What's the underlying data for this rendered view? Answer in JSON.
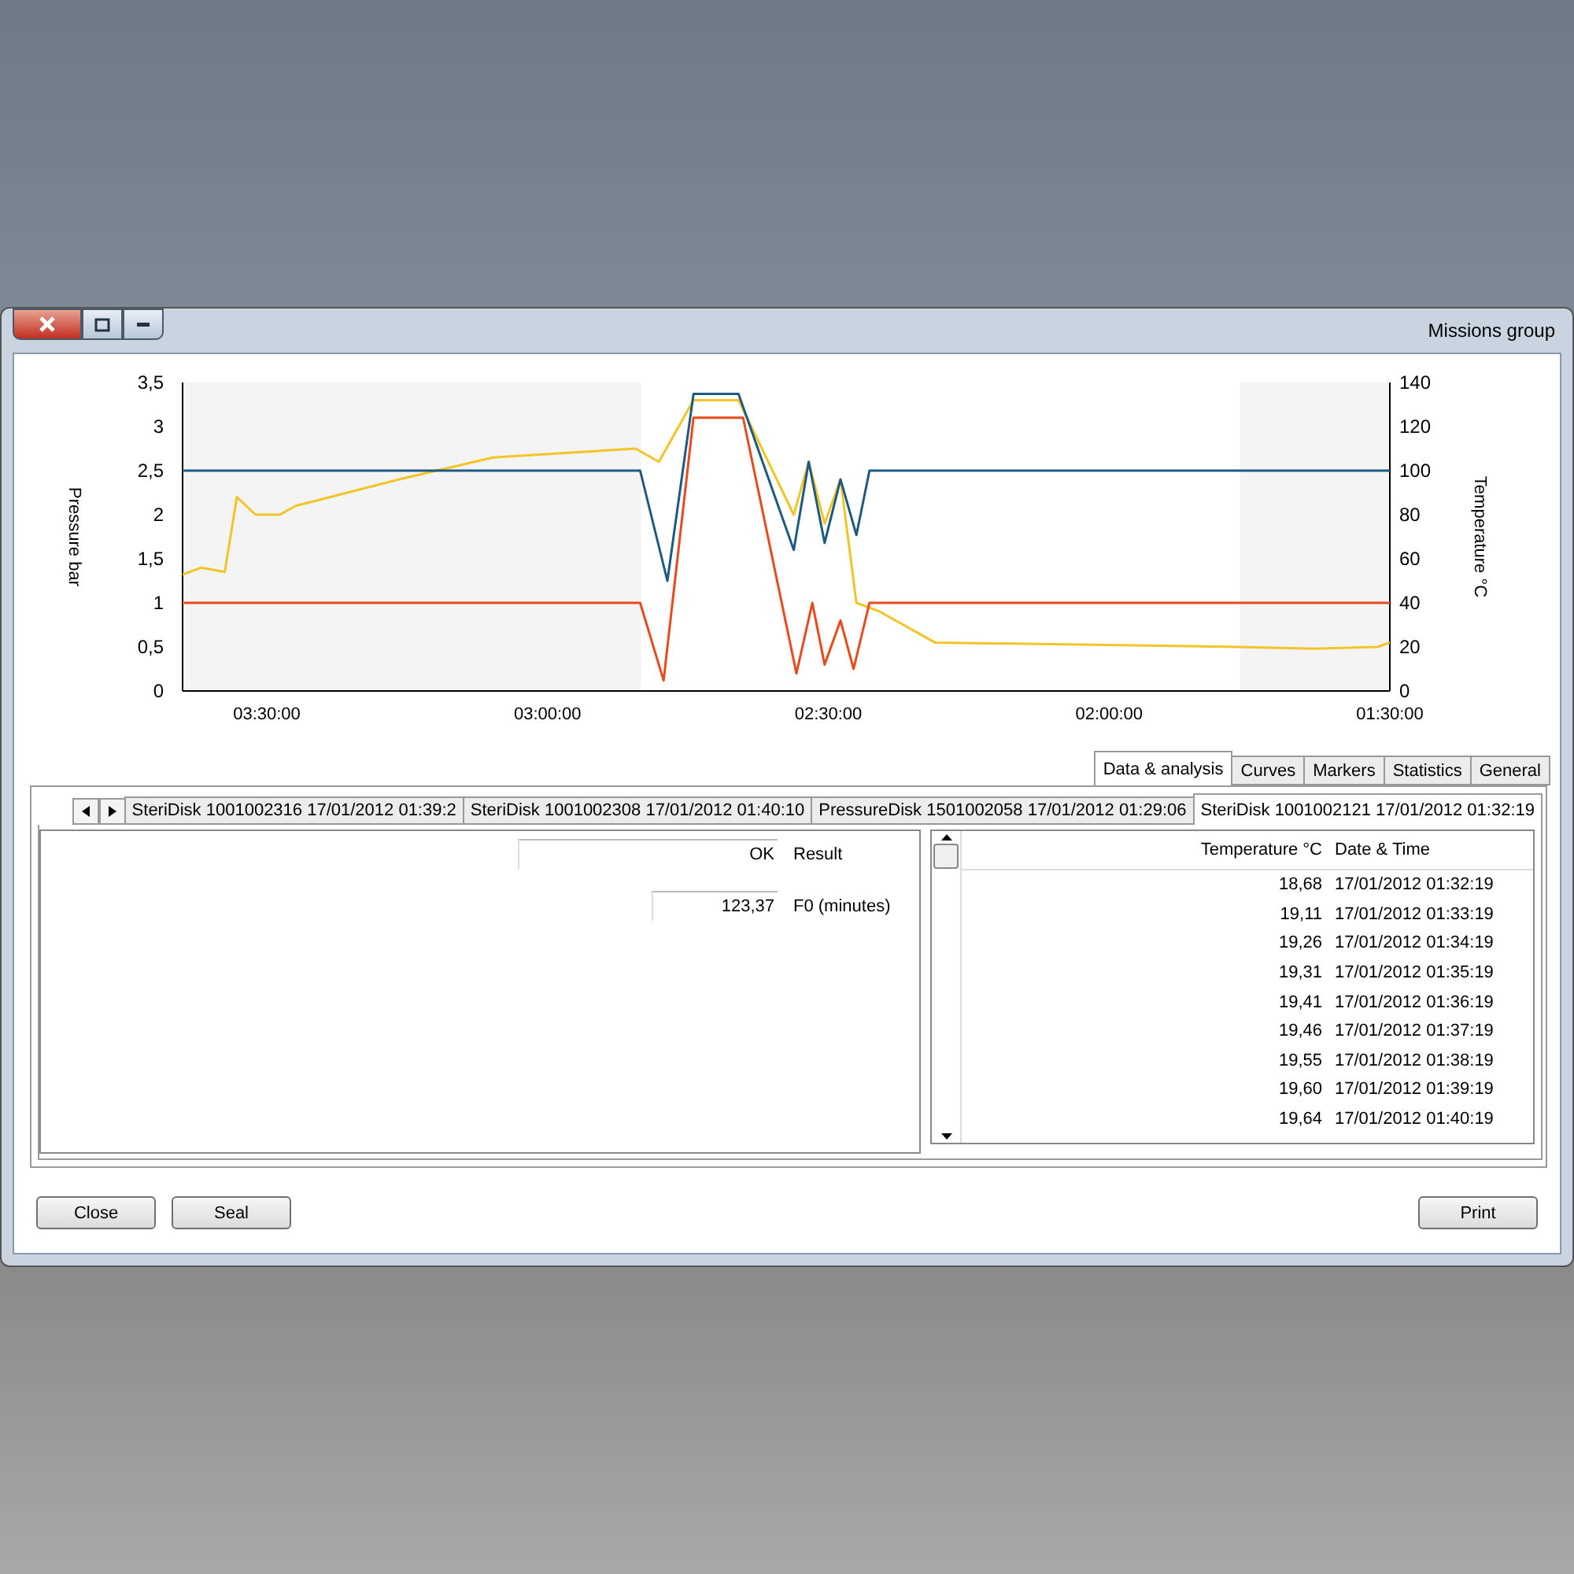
{
  "window": {
    "title": "Missions group"
  },
  "chart": {
    "y_label_left": "Pressure bar",
    "y_label_right": "Temperature °C",
    "chart_data": {
      "type": "line",
      "xlim": [
        219,
        90
      ],
      "ylim": [
        0,
        3.5
      ],
      "xticks": [
        {
          "value": 210,
          "label": "03:30:00"
        },
        {
          "value": 180,
          "label": "03:00:00"
        },
        {
          "value": 150,
          "label": "02:30:00"
        },
        {
          "value": 120,
          "label": "02:00:00"
        },
        {
          "value": 90,
          "label": "01:30:00"
        }
      ],
      "yticks": [
        {
          "value": 0,
          "label": "0"
        },
        {
          "value": 0.5,
          "label": "0,5"
        },
        {
          "value": 1,
          "label": "1"
        },
        {
          "value": 1.5,
          "label": "1,5"
        },
        {
          "value": 2,
          "label": "2"
        },
        {
          "value": 2.5,
          "label": "2,5"
        },
        {
          "value": 3,
          "label": "3"
        },
        {
          "value": 3.5,
          "label": "3,5"
        }
      ],
      "y2lim": [
        0,
        140
      ],
      "y2ticks": [
        0,
        20,
        40,
        60,
        80,
        100,
        120,
        140
      ],
      "bands": [
        {
          "axis": "x",
          "from": 219,
          "to": 170
        },
        {
          "axis": "x",
          "from": 106,
          "to": 90
        }
      ],
      "series": [
        {
          "color": "#f2c428",
          "x": [
            219,
            217,
            214.5,
            213.2,
            211.2,
            208.6,
            206.9,
            195.9,
            185.8,
            170.6,
            168.1,
            164.4,
            159.6,
            153.7,
            152.1,
            150.4,
            148.7,
            147,
            144.5,
            138.6,
            106.5,
            98.1,
            91.3,
            90
          ],
          "values": [
            1.32,
            1.4,
            1.35,
            2.2,
            2.0,
            2.0,
            2.1,
            2.4,
            2.65,
            2.75,
            2.6,
            3.3,
            3.3,
            2.0,
            2.6,
            1.9,
            2.4,
            1.0,
            0.9,
            0.55,
            0.5,
            0.48,
            0.5,
            0.55
          ]
        },
        {
          "color": "#1d5a80",
          "x": [
            219,
            170.1,
            167.2,
            164.4,
            159.6,
            153.7,
            152.1,
            150.4,
            148.7,
            147,
            145.6,
            90
          ],
          "values": [
            2.5,
            2.5,
            1.25,
            3.37,
            3.37,
            1.6,
            2.6,
            1.68,
            2.4,
            1.77,
            2.5,
            2.5
          ]
        },
        {
          "color": "#e84a1c",
          "x": [
            219,
            170.1,
            167.6,
            164.4,
            159.1,
            153.4,
            151.7,
            150.4,
            148.7,
            147.3,
            145.6,
            90
          ],
          "values": [
            1.0,
            1.0,
            0.12,
            3.1,
            3.1,
            0.2,
            1.0,
            0.3,
            0.8,
            0.25,
            1.0,
            1.0
          ]
        }
      ]
    }
  },
  "tabs": [
    {
      "label": "Data & analysis",
      "selected": true
    },
    {
      "label": "Curves",
      "selected": false
    },
    {
      "label": "Markers",
      "selected": false
    },
    {
      "label": "Statistics",
      "selected": false
    },
    {
      "label": "General",
      "selected": false
    }
  ],
  "subtabs": [
    {
      "label": "SteriDisk 1001002316 17/01/2012 01:39:2",
      "selected": false
    },
    {
      "label": "SteriDisk 1001002308 17/01/2012 01:40:10",
      "selected": false
    },
    {
      "label": "PressureDisk 1501002058 17/01/2012 01:29:06",
      "selected": false
    },
    {
      "label": "SteriDisk 1001002121 17/01/2012 01:32:19",
      "selected": true
    }
  ],
  "table": {
    "columns": [
      "Temperature °C",
      "Date & Time"
    ],
    "rows": [
      [
        "18,68",
        "17/01/2012 01:32:19"
      ],
      [
        "19,11",
        "17/01/2012 01:33:19"
      ],
      [
        "19,26",
        "17/01/2012 01:34:19"
      ],
      [
        "19,31",
        "17/01/2012 01:35:19"
      ],
      [
        "19,41",
        "17/01/2012 01:36:19"
      ],
      [
        "19,46",
        "17/01/2012 01:37:19"
      ],
      [
        "19,55",
        "17/01/2012 01:38:19"
      ],
      [
        "19,60",
        "17/01/2012 01:39:19"
      ],
      [
        "19,64",
        "17/01/2012 01:40:19"
      ]
    ]
  },
  "results": [
    {
      "label": "Result",
      "value": "OK"
    },
    {
      "label": "F0 (minutes)",
      "value": "123,37"
    }
  ],
  "buttons": {
    "left": [
      "Close",
      "Seal"
    ],
    "right": [
      "Print"
    ]
  }
}
